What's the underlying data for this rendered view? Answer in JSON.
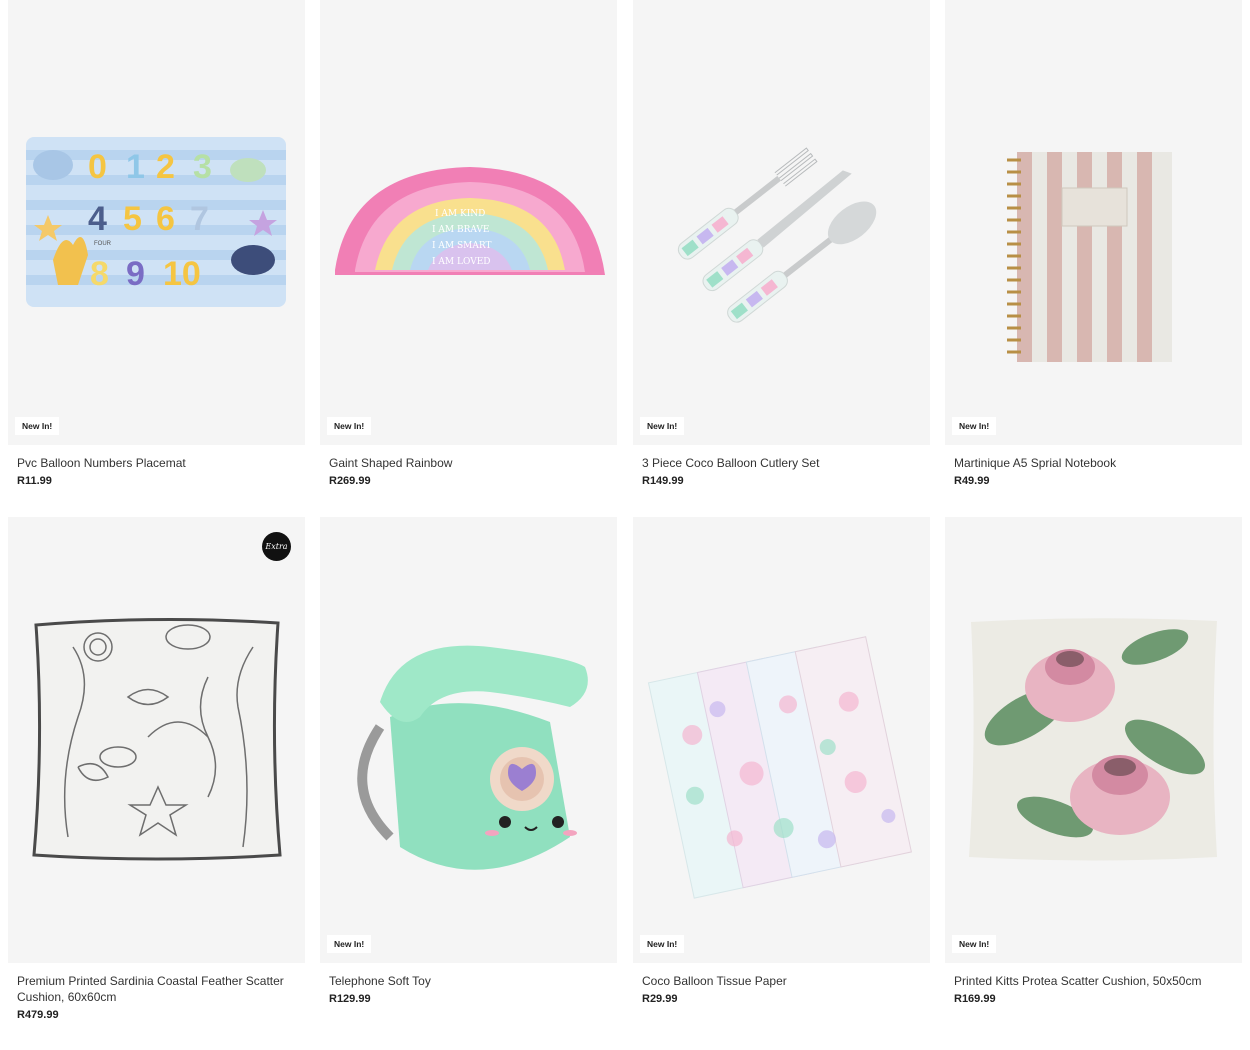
{
  "products": [
    {
      "title": "Pvc Balloon Numbers Placemat",
      "price": "R11.99",
      "badge": "New In!"
    },
    {
      "title": "Gaint Shaped Rainbow",
      "price": "R269.99",
      "badge": "New In!"
    },
    {
      "title": "3 Piece Coco Balloon Cutlery Set",
      "price": "R149.99",
      "badge": "New In!"
    },
    {
      "title": "Martinique A5 Sprial Notebook",
      "price": "R49.99",
      "badge": "New In!"
    },
    {
      "title": "Premium Printed Sardinia Coastal Feather Scatter Cushion, 60x60cm",
      "price": "R479.99",
      "badge": "Extra"
    },
    {
      "title": "Telephone Soft Toy",
      "price": "R129.99",
      "badge": "New In!"
    },
    {
      "title": "Coco Balloon Tissue Paper",
      "price": "R29.99",
      "badge": "New In!"
    },
    {
      "title": "Printed Kitts Protea Scatter Cushion, 50x50cm",
      "price": "R169.99",
      "badge": "New In!"
    }
  ],
  "placemat": {
    "digits": [
      "0",
      "1",
      "2",
      "3",
      "4",
      "5",
      "6",
      "7",
      "8",
      "9",
      "10"
    ],
    "word": "FOUR"
  },
  "rainbow": {
    "lines": [
      "I AM KIND",
      "I AM BRAVE",
      "I AM SMART",
      "I AM LOVED"
    ]
  }
}
